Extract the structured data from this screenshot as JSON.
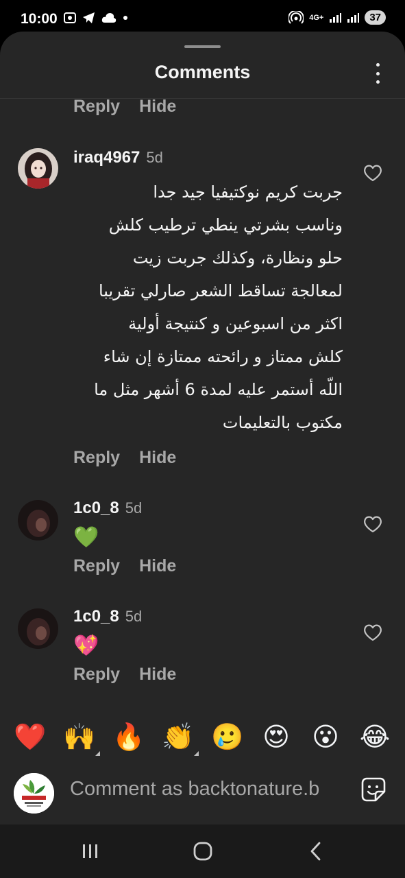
{
  "status_bar": {
    "time": "10:00",
    "left_icons": [
      "screen-record-icon",
      "telegram-icon",
      "cloud-icon",
      "dot-icon"
    ],
    "network": "4G+",
    "battery": "37"
  },
  "sheet": {
    "title": "Comments"
  },
  "actions": {
    "reply_label": "Reply",
    "hide_label": "Hide"
  },
  "comments": [
    {
      "username": "iraq4967",
      "time": "5d",
      "lines": [
        "جربت كريم نوكتيفيا جيد جدا",
        "وناسب بشرتي ينطي ترطيب كلش",
        "حلو ونظارة،  وكذلك جربت زيت",
        "لمعالجة تساقط الشعر صارلي تقريبا",
        "اكثر من اسبوعين و كنتيجة أولية",
        "كلش ممتاز و رائحته ممتازة إن شاء",
        "اللّه أستمر عليه لمدة 6 أشهر مثل ما",
        "مكتوب بالتعليمات"
      ]
    },
    {
      "username": "1c0_8",
      "time": "5d",
      "text": "💚"
    },
    {
      "username": "1c0_8",
      "time": "5d",
      "text": "💖"
    }
  ],
  "reactions": [
    "❤️",
    "🙌",
    "🔥",
    "👏",
    "🥲",
    "😍",
    "😮",
    "😂"
  ],
  "composer": {
    "placeholder": "Comment as backtonature.b",
    "avatar_text": "BACK TO NATURE"
  },
  "colors": {
    "sheet_bg": "#262626",
    "muted_text": "#a8a8a8",
    "primary_text": "#f5f5f5"
  }
}
